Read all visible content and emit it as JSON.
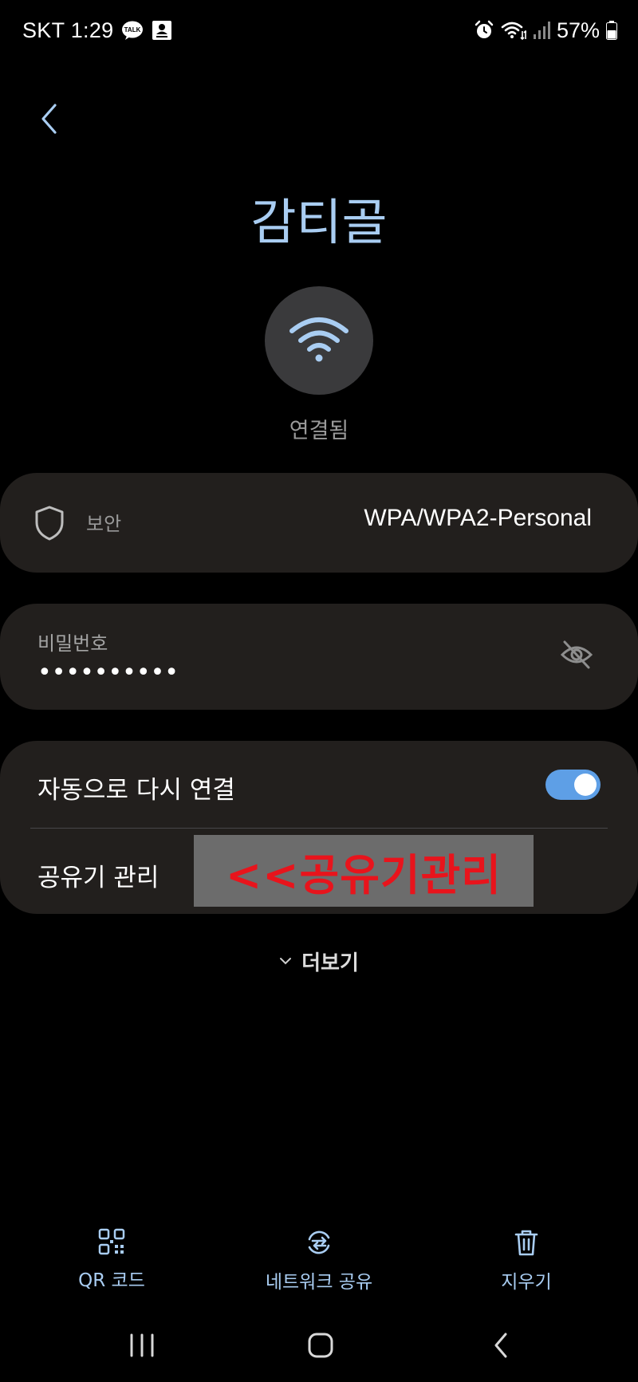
{
  "status_bar": {
    "time": "SKT 1:29",
    "battery_percent": "57%",
    "notification_icons": [
      "talk-icon",
      "contact-card-icon"
    ],
    "system_icons": [
      "alarm-icon",
      "wifi-icon",
      "signal-icon",
      "battery-icon"
    ]
  },
  "header": {
    "back_icon": "chevron-left-icon",
    "network_name": "감티골"
  },
  "connection": {
    "icon": "wifi-icon",
    "status": "연결됨"
  },
  "security": {
    "icon": "shield-icon",
    "label": "보안",
    "value": "WPA/WPA2-Personal"
  },
  "password": {
    "label": "비밀번호",
    "masked_value": "••••••••••",
    "visibility_icon": "eye-off-icon"
  },
  "options": {
    "auto_reconnect": {
      "label": "자동으로 다시 연결",
      "enabled": true
    },
    "router_management": {
      "label": "공유기 관리"
    }
  },
  "annotation": {
    "text": "<<공유기관리"
  },
  "more": {
    "label": "더보기",
    "icon": "chevron-down-icon"
  },
  "actions": [
    {
      "label": "QR 코드",
      "icon": "qr-code-icon"
    },
    {
      "label": "네트워크 공유",
      "icon": "share-network-icon"
    },
    {
      "label": "지우기",
      "icon": "trash-icon"
    }
  ],
  "colors": {
    "background": "#000000",
    "card": "#221f1d",
    "accent": "#a9cdf2",
    "toggle_on": "#5e9fe6",
    "annotation_text": "#e8141c",
    "annotation_bg": "#6c6c6c"
  }
}
